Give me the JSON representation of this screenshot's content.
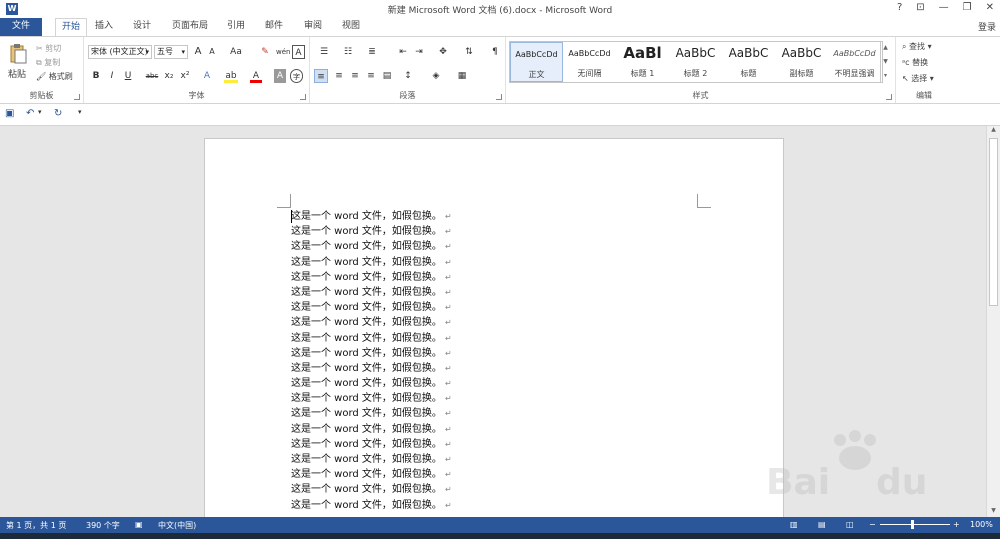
{
  "titlebar": {
    "logo": "W",
    "title": "新建 Microsoft Word 文档 (6).docx - Microsoft Word",
    "help": "?",
    "ribbon_display": "⊡",
    "minimize": "—",
    "restore": "❐",
    "close": "✕"
  },
  "tabs": {
    "file": "文件",
    "items": [
      "开始",
      "插入",
      "设计",
      "页面布局",
      "引用",
      "邮件",
      "审阅",
      "视图"
    ],
    "active": "开始",
    "login": "登录"
  },
  "clipboard": {
    "paste": "粘贴",
    "cut": "剪切",
    "copy": "复制",
    "format_painter": "格式刷",
    "label": "剪贴板"
  },
  "font": {
    "name": "宋体 (中文正文)",
    "size": "五号",
    "grow": "A",
    "shrink": "A",
    "case": "Aa",
    "bold": "B",
    "italic": "I",
    "underline": "U",
    "strike": "abc",
    "sub": "x₂",
    "sup": "x²",
    "label": "字体"
  },
  "paragraph": {
    "label": "段落"
  },
  "styles": {
    "label": "样式",
    "items": [
      {
        "sample": "AaBbCcDd",
        "name": "正文"
      },
      {
        "sample": "AaBbCcDd",
        "name": "无间隔"
      },
      {
        "sample": "AaBl",
        "name": "标题 1"
      },
      {
        "sample": "AaBbC",
        "name": "标题 2"
      },
      {
        "sample": "AaBbC",
        "name": "标题"
      },
      {
        "sample": "AaBbC",
        "name": "副标题"
      },
      {
        "sample": "AaBbCcDd",
        "name": "不明显强调"
      }
    ]
  },
  "editing": {
    "find": "查找",
    "replace": "替换",
    "select": "选择",
    "label": "编辑"
  },
  "document": {
    "line_text": "这是一个 word 文件，如假包换。",
    "paragraph_mark": "↵",
    "line_count": 20
  },
  "status": {
    "page": "第 1 页，共 1 页",
    "words": "390 个字",
    "language": "中文(中国)",
    "zoom": "100%",
    "zoom_minus": "−",
    "zoom_plus": "+"
  },
  "colors": {
    "brand": "#2b579a"
  }
}
